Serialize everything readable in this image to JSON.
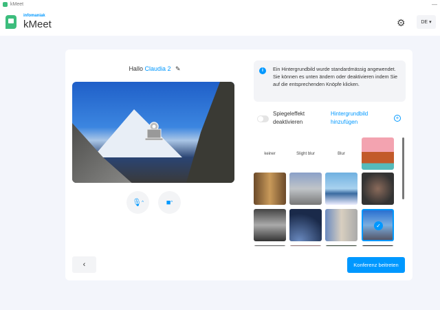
{
  "window": {
    "title": "kMeet"
  },
  "header": {
    "brand_small": "infomaniak",
    "brand": "kMeet",
    "lang": "DE"
  },
  "left": {
    "greeting": "Hallo",
    "user_name": "Claudia 2"
  },
  "info": {
    "text": "Ein Hintergrundbild wurde standardmässig angewendet. Sie können es unten ändern oder deaktivieren indem Sie auf die entsprechenden Knöpfe klicken."
  },
  "mirror": {
    "label": "Spiegeleffekt deaktivieren",
    "enabled": false
  },
  "add_background": "Hintergrundbild hinzufügen",
  "backgrounds": {
    "options": [
      "keiner",
      "Slight blur",
      "Blur"
    ],
    "selected": "matterhorn"
  },
  "join_button": "Konferenz beitreten",
  "colors": {
    "accent": "#0098ff",
    "brand_green": "#3dbd7d"
  }
}
